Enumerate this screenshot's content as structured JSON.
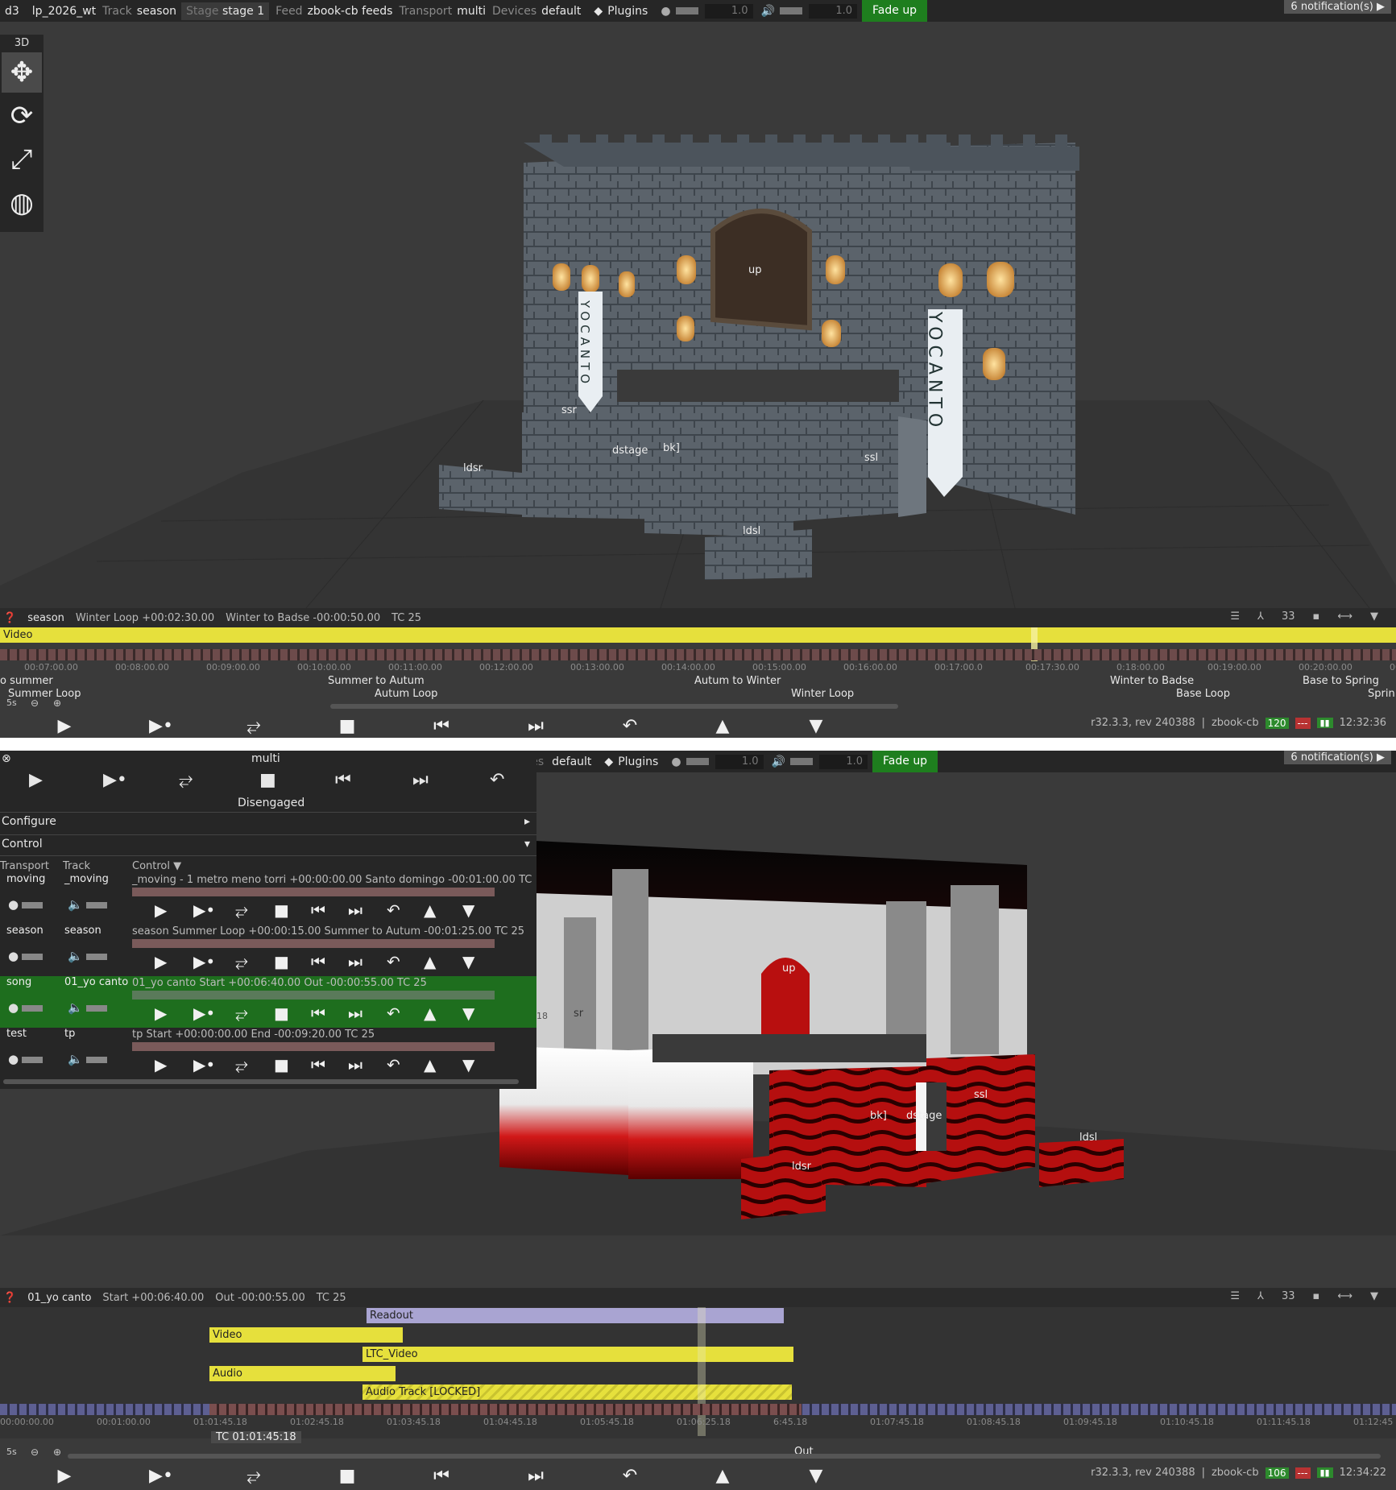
{
  "top": {
    "topbar": {
      "app": "d3",
      "project": "lp_2026_wt",
      "track_label": "Track",
      "track_value": "season",
      "stage_label": "Stage",
      "stage_value": "stage 1",
      "feed_label": "Feed",
      "feed_value": "zbook-cb feeds",
      "transport_label": "Transport",
      "transport_value": "multi",
      "devices_label": "Devices",
      "devices_value": "default",
      "plugins": "Plugins",
      "light_value": "1.0",
      "volume_value": "1.0",
      "fade_up": "Fade up",
      "notifications": "6 notification(s)"
    },
    "toolbox_label": "3D",
    "scene_labels": {
      "up": "up",
      "ssr": "ssr",
      "dstage": "dstage",
      "bk": "bk]",
      "ssl": "ssl",
      "ldsr": "ldsr",
      "ldsl": "ldsl"
    },
    "banner_text": "YOCANTO",
    "status": {
      "track": "season",
      "current": "Winter Loop +00:02:30.00",
      "next": "Winter to Badse -00:00:50.00",
      "tc": "TC 25",
      "layers": "33"
    },
    "layer_name": "Video",
    "timecodes": [
      "00:07:00.00",
      "00:08:00.00",
      "00:09:00.00",
      "00:10:00.00",
      "00:11:00.00",
      "00:12:00.00",
      "00:13:00.00",
      "00:14:00.00",
      "00:15:00.00",
      "00:16:00.00",
      "00:17:00.0",
      "00:17:30.00",
      "0:18:00.00",
      "00:19:00.00",
      "00:20:00.00",
      "00:21:0"
    ],
    "sections": [
      {
        "text": "o summer",
        "row": 0
      },
      {
        "text": "Summer Loop",
        "row": 1
      },
      {
        "text": "Summer to Autum",
        "row": 0
      },
      {
        "text": "Autum Loop",
        "row": 1
      },
      {
        "text": "Autum to Winter",
        "row": 0
      },
      {
        "text": "Winter Loop",
        "row": 1
      },
      {
        "text": "Winter to Badse",
        "row": 0
      },
      {
        "text": "Base Loop",
        "row": 1
      },
      {
        "text": "Base to Spring",
        "row": 0
      },
      {
        "text": "Sprin",
        "row": 1
      }
    ],
    "zoom": "5s",
    "version": "r32.3.3, rev 240388",
    "machine": "zbook-cb",
    "fps": "120",
    "clock": "12:32:36"
  },
  "bottom": {
    "multi": {
      "title": "multi",
      "state": "Disengaged",
      "configure": "Configure",
      "control": "Control",
      "col_transport": "Transport",
      "col_track": "Track",
      "col_control": "Control",
      "rows": [
        {
          "transport": "moving",
          "track": "_moving",
          "info": "_moving    - 1 metro meno torri +00:00:00.00   Santo domingo -00:01:00.00   TC",
          "active": false
        },
        {
          "transport": "season",
          "track": "season",
          "info": "season    Summer Loop +00:00:15.00   Summer to Autum -00:01:25.00   TC 25",
          "active": false
        },
        {
          "transport": "song",
          "track": "01_yo canto",
          "info": "01_yo canto    Start +00:06:40.00   Out -00:00:55.00   TC 25",
          "active": true
        },
        {
          "transport": "test",
          "track": "tp",
          "info": "tp    Start +00:00:00.00   End -00:09:20.00   TC 25",
          "active": false
        }
      ]
    },
    "topbar": {
      "devices_value": "default",
      "prefix": "es",
      "plugins": "Plugins",
      "light_value": "1.0",
      "volume_value": "1.0",
      "fade_up": "Fade up",
      "notifications": "6 notification(s)"
    },
    "scene_labels": {
      "up": "up",
      "ssl": "ssl",
      "bk": "bk]",
      "dstage": "dstage",
      "ldsr": "ldsr",
      "ldsl": "ldsl",
      "sr": "sr",
      "n18": "18"
    },
    "status": {
      "track": "01_yo canto",
      "current": "Start +00:06:40.00",
      "next": "Out -00:00:55.00",
      "tc": "TC 25",
      "layers": "33"
    },
    "layers": [
      {
        "name": "Readout",
        "color": "#a9a4d2"
      },
      {
        "name": "Video",
        "color": "#e6e03c"
      },
      {
        "name": "LTC_Video",
        "color": "#e6e03c"
      },
      {
        "name": "Audio",
        "color": "#e6e03c"
      },
      {
        "name": "Audio Track [LOCKED]",
        "color": "#e6e03c"
      }
    ],
    "timecodes": [
      "00:00:00.00",
      "00:01:00.00",
      "01:01:45.18",
      "01:02:45.18",
      "01:03:45.18",
      "01:04:45.18",
      "01:05:45.18",
      "01:06:25.18",
      "6:45.18",
      "01:07:45.18",
      "01:08:45.18",
      "01:09:45.18",
      "01:10:45.18",
      "01:11:45.18",
      "01:12:45"
    ],
    "tc_readout": "TC 01:01:45:18",
    "out_label": "Out",
    "zoom": "5s",
    "version": "r32.3.3, rev 240388",
    "machine": "zbook-cb",
    "fps": "106",
    "clock": "12:34:22"
  }
}
